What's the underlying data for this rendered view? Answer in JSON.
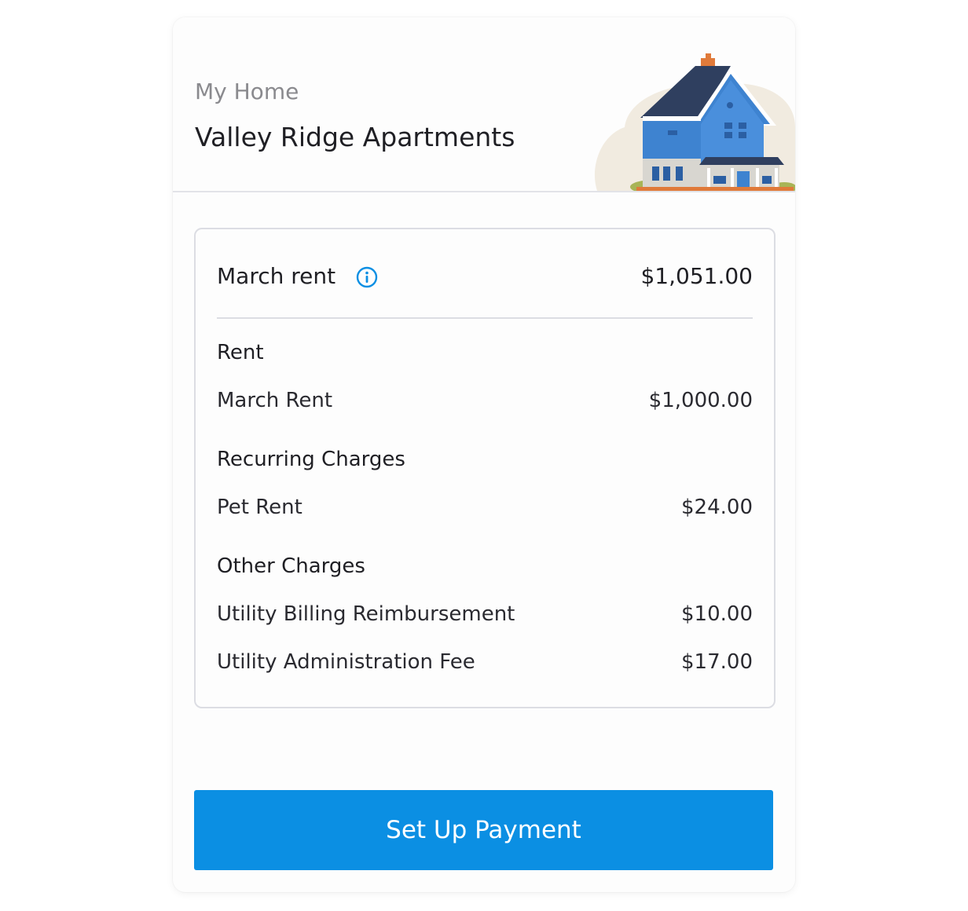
{
  "header": {
    "eyebrow": "My Home",
    "property_name": "Valley Ridge Apartments",
    "illustration": "house-illustration"
  },
  "summary": {
    "label": "March rent",
    "info_icon": "info-icon",
    "total": "$1,051.00"
  },
  "sections": [
    {
      "title": "Rent",
      "items": [
        {
          "label": "March Rent",
          "amount": "$1,000.00"
        }
      ]
    },
    {
      "title": "Recurring Charges",
      "items": [
        {
          "label": "Pet Rent",
          "amount": "$24.00"
        }
      ]
    },
    {
      "title": "Other Charges",
      "items": [
        {
          "label": "Utility Billing Reimbursement",
          "amount": "$10.00"
        },
        {
          "label": "Utility Administration Fee",
          "amount": "$17.00"
        }
      ]
    }
  ],
  "actions": {
    "primary_label": "Set Up Payment"
  },
  "colors": {
    "accent": "#0b8fe3",
    "text": "#1f1f24",
    "muted": "#8a8a8e",
    "border": "#dcdde3"
  }
}
